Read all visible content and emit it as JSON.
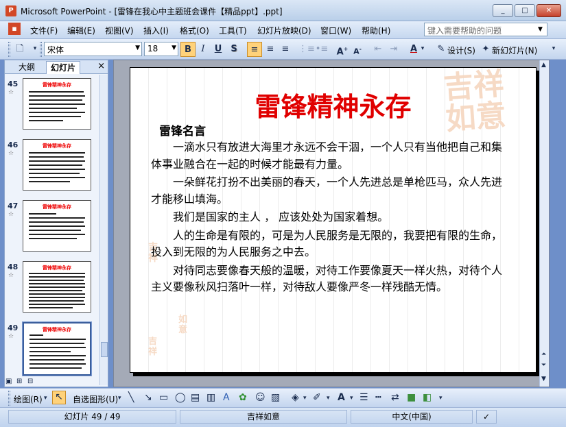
{
  "window": {
    "title": "Microsoft PowerPoint - [雷锋在我心中主题班会课件【精品ppt】.ppt]",
    "app_icon_label": "P",
    "minimize": "_",
    "restore": "□",
    "close": "✕"
  },
  "menu": {
    "file": "文件(F)",
    "edit": "编辑(E)",
    "view": "视图(V)",
    "insert": "插入(I)",
    "format": "格式(O)",
    "tools": "工具(T)",
    "slideshow": "幻灯片放映(D)",
    "window": "窗口(W)",
    "help": "帮助(H)",
    "help_search_placeholder": "键入需要帮助的问题"
  },
  "toolbar": {
    "font_name": "宋体",
    "font_size": "18",
    "bold": "B",
    "italic": "I",
    "underline": "U",
    "shadow": "S",
    "design": "设计(S)",
    "new_slide": "新幻灯片(N)"
  },
  "left_pane": {
    "tab_outline": "大纲",
    "tab_slides": "幻灯片",
    "close": "×",
    "thumbnails": [
      {
        "number": "45",
        "title": "雷锋精神永存"
      },
      {
        "number": "46",
        "title": "雷锋精神永存"
      },
      {
        "number": "47",
        "title": "雷锋精神永存"
      },
      {
        "number": "48",
        "title": "雷锋精神永存"
      },
      {
        "number": "49",
        "title": "雷锋精神永存"
      }
    ]
  },
  "slide": {
    "title": "雷锋精神永存",
    "subtitle": "雷锋名言",
    "paragraphs": [
      "一滴水只有放进大海里才永远不会干涸，一个人只有当他把自己和集体事业融合在一起的时候才能最有力量。",
      "一朵鲜花打扮不出美丽的春天，一个人先进总是单枪匹马，众人先进才能移山填海。",
      "我们是国家的主人 ， 应该处处为国家着想。",
      "人的生命是有限的，可是为人民服务是无限的，我要把有限的生命，投入到无限的为人民服务之中去。",
      "对待同志要像春天般的温暖，对待工作要像夏天一样火热，对待个人主义要像秋风扫落叶一样，对待敌人要像严冬一样残酷无情。"
    ],
    "decoration_text_1": "吉祥",
    "decoration_text_2": "如意"
  },
  "drawing_toolbar": {
    "draw": "绘图(R)",
    "autoshapes": "自选图形(U)"
  },
  "status": {
    "slide_position": "幻灯片 49 / 49",
    "design_template": "吉祥如意",
    "language": "中文(中国)"
  },
  "colors": {
    "title_red": "#e00000",
    "chrome_blue": "#c5d7ef",
    "workspace_blue": "#6e8fc9"
  }
}
